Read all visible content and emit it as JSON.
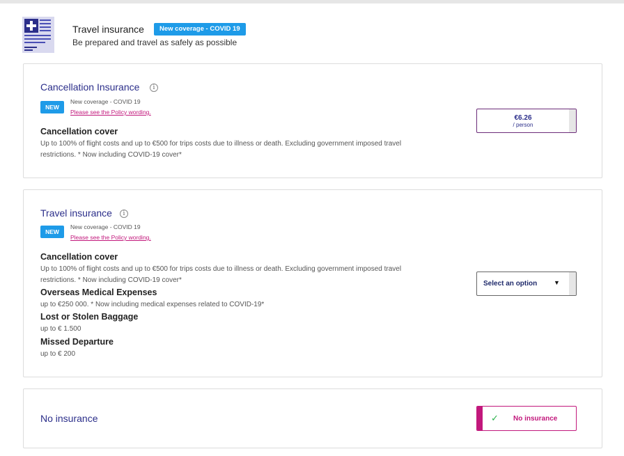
{
  "header": {
    "title": "Travel insurance",
    "badge": "New coverage - COVID 19",
    "subtitle": "Be prepared and travel as safely as possible"
  },
  "cancellation": {
    "title": "Cancellation Insurance",
    "info_icon": "i",
    "new_badge": "NEW",
    "coverage_text": "New coverage - COVID 19",
    "policy_link": "Please see the Policy wording.",
    "section_title": "Cancellation cover",
    "section_desc": "Up to 100% of flight costs and up to €500 for trips costs due to illness or death. Excluding government imposed travel restrictions. * Now including COVID-19 cover*",
    "price": "€6.26",
    "price_unit": "/ person"
  },
  "travel": {
    "title": "Travel insurance",
    "info_icon": "i",
    "new_badge": "NEW",
    "coverage_text": "New coverage - COVID 19",
    "policy_link": "Please see the Policy wording.",
    "sections": [
      {
        "title": "Cancellation cover",
        "desc": "Up to 100% of flight costs and up to €500 for trips costs due to illness or death. Excluding government imposed travel restrictions. * Now including COVID-19 cover*"
      },
      {
        "title": "Overseas Medical Expenses",
        "desc": "up to €250 000. * Now including medical expenses related to COVID-19*"
      },
      {
        "title": "Lost or Stolen Baggage",
        "desc": "up to € 1.500"
      },
      {
        "title": "Missed Departure",
        "desc": "up to € 200"
      }
    ],
    "select_label": "Select an option",
    "caret": "▼"
  },
  "no_insurance": {
    "title": "No insurance",
    "button_label": "No insurance",
    "check": "✓"
  },
  "colors": {
    "accent_blue": "#1e9be8",
    "title_navy": "#2b2e8a",
    "magenta": "#c2187c",
    "check_green": "#2bb24c"
  }
}
